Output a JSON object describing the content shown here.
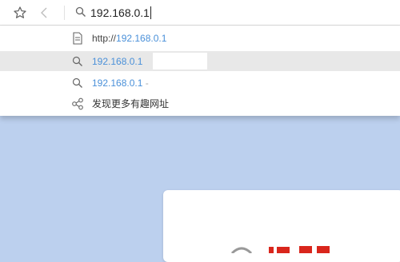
{
  "toolbar": {
    "address_value": "192.168.0.1"
  },
  "suggestions": [
    {
      "icon": "page-icon",
      "prefix": "http://",
      "highlight": "192.168.0.1",
      "selected": false
    },
    {
      "icon": "search-icon",
      "highlight": "192.168.0.1",
      "selected": true
    },
    {
      "icon": "search-icon",
      "highlight": "192.168.0.1",
      "suffix": "-",
      "selected": false
    },
    {
      "icon": "share-icon",
      "text": "发现更多有趣网址",
      "selected": false
    }
  ],
  "colors": {
    "accent_blue": "#4a90d9",
    "page_background": "#bcd0ee",
    "selected_row": "#e8e8e8"
  }
}
